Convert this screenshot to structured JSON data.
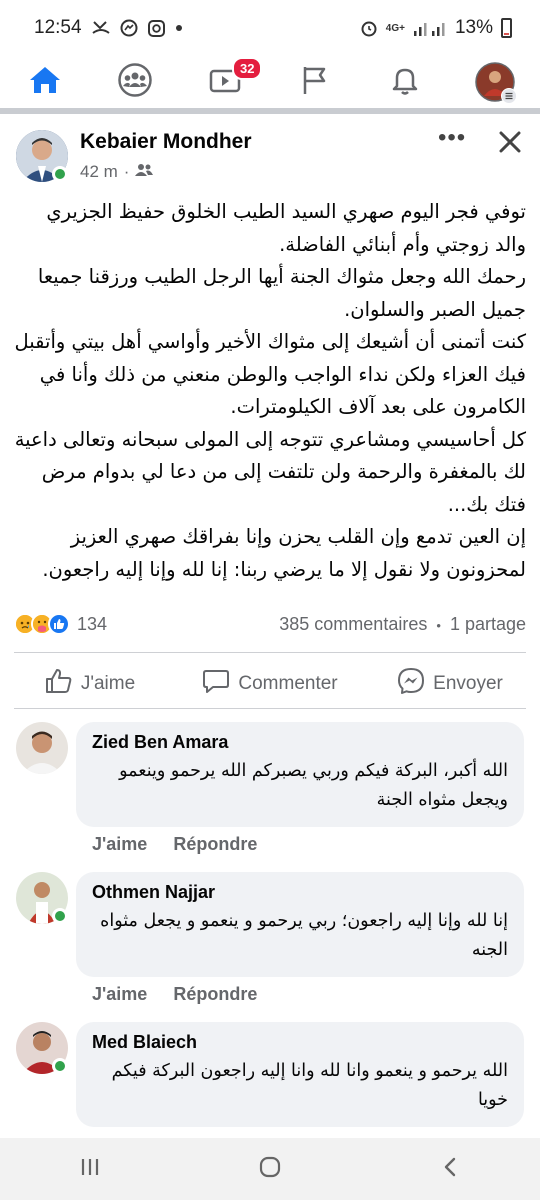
{
  "status_bar": {
    "time": "12:54",
    "battery": "13%",
    "network": "4G+"
  },
  "nav": {
    "video_badge": "32"
  },
  "post": {
    "author": "Kebaier Mondher",
    "time": "42 m",
    "dot": "·",
    "paragraphs": [
      "توفي فجر اليوم صهري السيد الطيب الخلوق حفيظ الجزيري والد زوجتي وأم أبنائي الفاضلة.",
      "رحمك الله وجعل مثواك الجنة أيها الرجل الطيب ورزقنا جميعا جميل الصبر والسلوان.",
      "كنت أتمنى أن أشيعك إلى مثواك الأخير وأواسي أهل بيتي وأتقبل فيك العزاء ولكن نداء الواجب والوطن منعني من ذلك وأنا في الكامرون على بعد آلاف الكيلومترات.",
      "كل أحاسيسي ومشاعري تتوجه إلى المولى سبحانه وتعالى داعية لك بالمغفرة والرحمة ولن تلتفت إلى من دعا لي بدوام مرض فتك بك...",
      "إن العين تدمع وإن القلب يحزن وإنا بفراقك صهري العزيز لمحزونون ولا نقول إلا ما يرضي ربنا: إنا لله وإنا إليه راجعون."
    ],
    "reaction_count": "134",
    "comments_count": "385 commentaires",
    "shares": "1 partage",
    "stats_sep": "•"
  },
  "actions": {
    "like": "J'aime",
    "comment": "Commenter",
    "send": "Envoyer"
  },
  "comments": [
    {
      "name": "Zied Ben Amara",
      "text": "الله أكبر، البركة فيكم وربي يصبركم الله يرحمو وينعمو ويجعل مثواه الجنة",
      "like": "J'aime",
      "reply": "Répondre"
    },
    {
      "name": "Othmen Najjar",
      "text": "إنا لله وإنا إليه راجعون؛ ربي يرحمو و ينعمو و يجعل مثواه الجنه",
      "like": "J'aime",
      "reply": "Répondre"
    },
    {
      "name": "Med Blaiech",
      "text": "الله يرحمو و ينعمو وانا لله وانا إليه راجعون البركة فيكم خويا"
    }
  ],
  "colors": {
    "accent": "#1877f2",
    "badge": "#e41e3f",
    "online": "#31a24c"
  }
}
